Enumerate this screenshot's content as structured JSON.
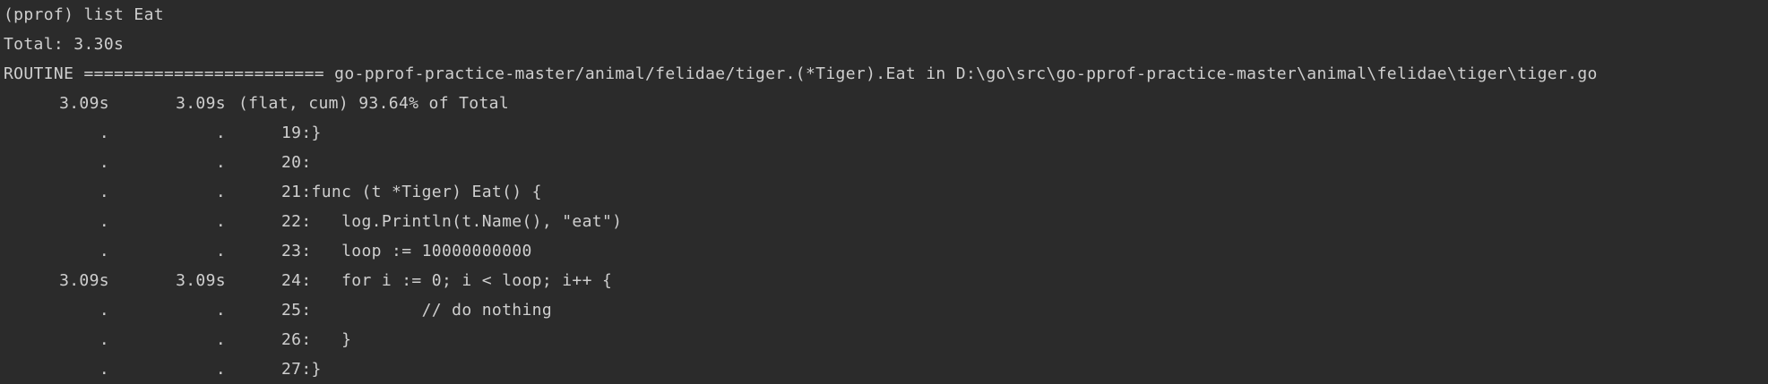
{
  "terminal": {
    "command_line": "(pprof) list Eat",
    "total_line": "Total: 3.30s",
    "routine_line": "ROUTINE ======================== go-pprof-practice-master/animal/felidae/tiger.(*Tiger).Eat in D:\\go\\src\\go-pprof-practice-master\\animal\\felidae\\tiger\\tiger.go",
    "summary": {
      "flat": "3.09s",
      "cum": "3.09s",
      "rest": "(flat, cum) 93.64% of Total"
    },
    "source_lines": [
      {
        "flat": ".",
        "cum": ".",
        "text": "19:}"
      },
      {
        "flat": ".",
        "cum": ".",
        "text": "20:"
      },
      {
        "flat": ".",
        "cum": ".",
        "text": "21:func (t *Tiger) Eat() {"
      },
      {
        "flat": ".",
        "cum": ".",
        "text": "22:   log.Println(t.Name(), \"eat\")"
      },
      {
        "flat": ".",
        "cum": ".",
        "text": "23:   loop := 10000000000"
      },
      {
        "flat": "3.09s",
        "cum": "3.09s",
        "text": "24:   for i := 0; i < loop; i++ {"
      },
      {
        "flat": ".",
        "cum": ".",
        "text": "25:           // do nothing"
      },
      {
        "flat": ".",
        "cum": ".",
        "text": "26:   }"
      },
      {
        "flat": ".",
        "cum": ".",
        "text": "27:}"
      }
    ]
  },
  "colors": {
    "background": "#2b2b2b",
    "text": "#cfcfcf"
  }
}
